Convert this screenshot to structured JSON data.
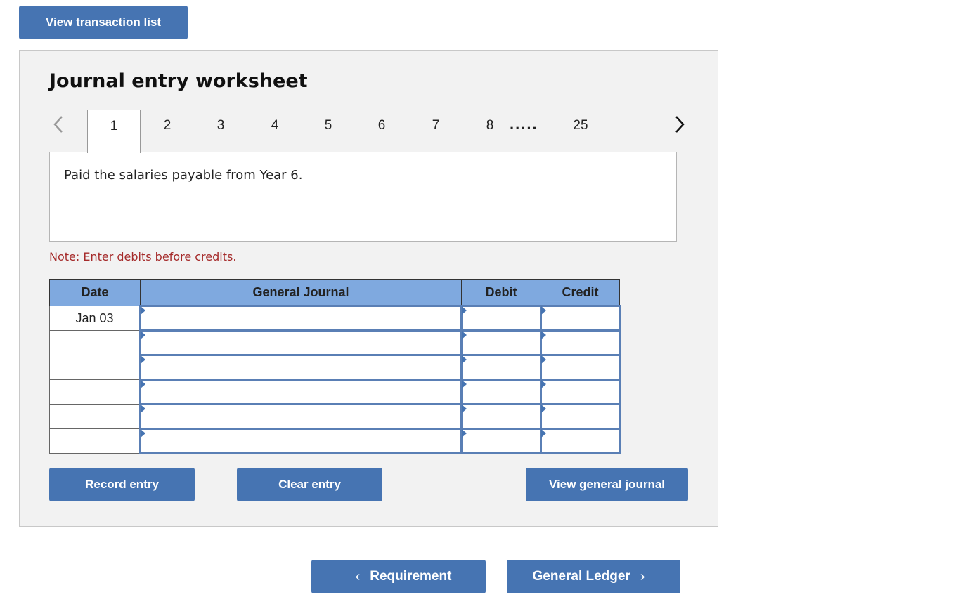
{
  "top_button": {
    "label": "View transaction list"
  },
  "worksheet": {
    "title": "Journal entry worksheet",
    "tabs": [
      {
        "label": "1",
        "active": true
      },
      {
        "label": "2",
        "active": false
      },
      {
        "label": "3",
        "active": false
      },
      {
        "label": "4",
        "active": false
      },
      {
        "label": "5",
        "active": false
      },
      {
        "label": "6",
        "active": false
      },
      {
        "label": "7",
        "active": false
      },
      {
        "label": "8",
        "active": false
      },
      {
        "label": "25",
        "active": false
      }
    ],
    "ellipsis": ".....",
    "transaction_description": "Paid the salaries payable from Year 6.",
    "note": "Note: Enter debits before credits.",
    "table": {
      "headers": {
        "date": "Date",
        "general_journal": "General Journal",
        "debit": "Debit",
        "credit": "Credit"
      },
      "rows": [
        {
          "date": "Jan 03",
          "account": "",
          "debit": "",
          "credit": ""
        },
        {
          "date": "",
          "account": "",
          "debit": "",
          "credit": ""
        },
        {
          "date": "",
          "account": "",
          "debit": "",
          "credit": ""
        },
        {
          "date": "",
          "account": "",
          "debit": "",
          "credit": ""
        },
        {
          "date": "",
          "account": "",
          "debit": "",
          "credit": ""
        },
        {
          "date": "",
          "account": "",
          "debit": "",
          "credit": ""
        }
      ]
    },
    "buttons": {
      "record": "Record entry",
      "clear": "Clear entry",
      "view_general_journal": "View general journal"
    }
  },
  "navigation": {
    "prev_label": "Requirement",
    "next_label": "General Ledger",
    "prev_icon": "chevron-left-icon",
    "next_icon": "chevron-right-icon"
  },
  "colors": {
    "button_blue": "#4674b2",
    "header_blue": "#7fa9df",
    "note_red": "#a52a2a",
    "panel_bg": "#f2f2f2"
  }
}
